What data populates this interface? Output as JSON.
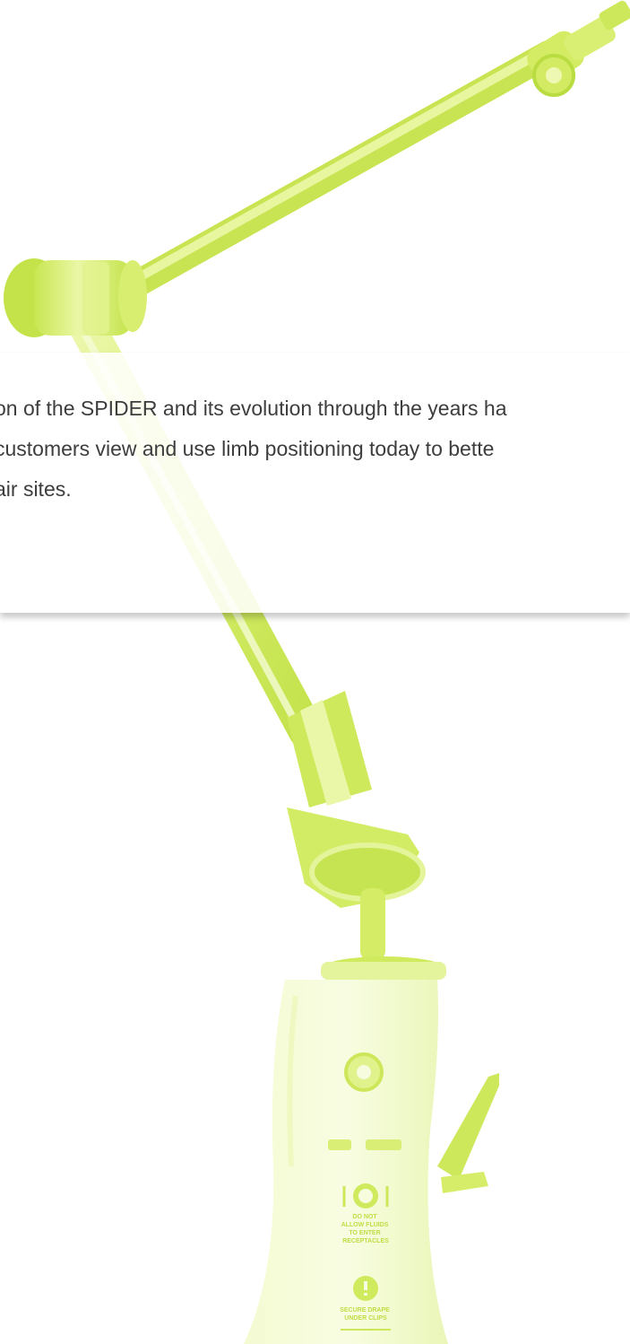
{
  "colors": {
    "device_fill": "#e6f58c",
    "device_mid": "#d0ec61",
    "device_shade": "#b8dd3f",
    "card_bg": "#ffffff",
    "text": "#3d3d3d"
  },
  "card": {
    "lines": [
      "on of the SPIDER and its evolution through the years ha",
      "customers view and use limb positioning today to bette",
      "air sites."
    ]
  },
  "device": {
    "icons": [
      "spider-limb-positioner-icon"
    ],
    "labels": {
      "rod_brand": "SPIDER",
      "fluids_warning": [
        "DO NOT",
        "ALLOW FLUIDS",
        "TO ENTER",
        "RECEPTACLES"
      ],
      "drape_warning": [
        "SECURE DRAPE",
        "UNDER CLIPS"
      ]
    }
  }
}
